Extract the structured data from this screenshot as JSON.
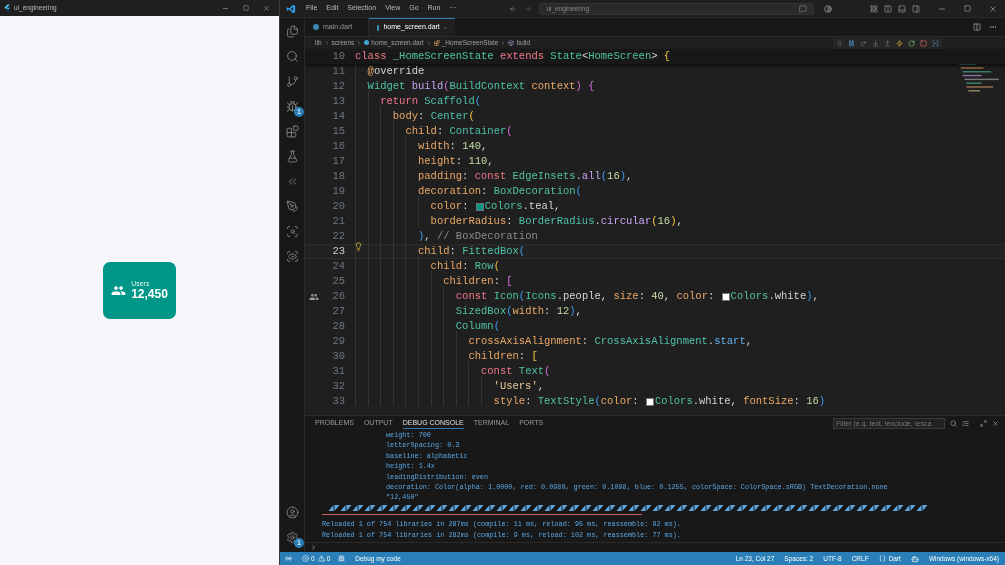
{
  "app_window": {
    "title": "ui_engineering",
    "card": {
      "label": "Users",
      "value": "12,450"
    }
  },
  "vscode": {
    "menu": [
      "File",
      "Edit",
      "Selection",
      "View",
      "Go",
      "Run",
      "···"
    ],
    "command_center": "ui_engineering",
    "activity_bar": [
      {
        "kind": "files"
      },
      {
        "kind": "search"
      },
      {
        "kind": "source-control"
      },
      {
        "kind": "run-debug",
        "badge": "1"
      },
      {
        "kind": "extensions"
      },
      {
        "kind": "testing"
      },
      {
        "kind": "flutter"
      },
      {
        "kind": "pen"
      },
      {
        "kind": "scan"
      },
      {
        "kind": "preview"
      }
    ],
    "activity_bottom": [
      {
        "kind": "account"
      },
      {
        "kind": "settings",
        "badge": "1"
      }
    ],
    "tabs": [
      {
        "label": "main.dart",
        "selected": false
      },
      {
        "label": "home_screen.dart",
        "selected": true
      }
    ],
    "breadcrumb": [
      {
        "label": "lib",
        "kind": "folder"
      },
      {
        "label": "screens",
        "kind": "folder"
      },
      {
        "label": "home_screen.dart",
        "kind": "file"
      },
      {
        "label": "_HomeScreenState",
        "kind": "class"
      },
      {
        "label": "build",
        "kind": "method"
      }
    ],
    "editor": {
      "lines": [
        {
          "number": "10",
          "sticky": true,
          "tokens": [
            {
              "text": "class ",
              "kind": "keyword"
            },
            {
              "text": "_HomeScreenState ",
              "kind": "type"
            },
            {
              "text": "extends ",
              "kind": "keyword"
            },
            {
              "text": "State",
              "kind": "type"
            },
            {
              "text": "<",
              "kind": "plain"
            },
            {
              "text": "HomeScreen",
              "kind": "type"
            },
            {
              "text": "> ",
              "kind": "plain"
            },
            {
              "text": "{",
              "kind": "bracket1"
            }
          ]
        },
        {
          "number": "11",
          "tokens": [
            {
              "text": "  @",
              "kind": "property"
            },
            {
              "text": "override",
              "kind": "plain"
            }
          ]
        },
        {
          "number": "12",
          "tokens": [
            {
              "text": "  Widget ",
              "kind": "type"
            },
            {
              "text": "build",
              "kind": "function"
            },
            {
              "text": "(",
              "kind": "bracket2"
            },
            {
              "text": "BuildContext ",
              "kind": "type"
            },
            {
              "text": "context",
              "kind": "property"
            },
            {
              "text": ")",
              "kind": "bracket2"
            },
            {
              "text": " {",
              "kind": "bracket2"
            }
          ]
        },
        {
          "number": "13",
          "tokens": [
            {
              "text": "    return ",
              "kind": "keyword"
            },
            {
              "text": "Scaffold",
              "kind": "type"
            },
            {
              "text": "(",
              "kind": "bracket3"
            }
          ]
        },
        {
          "number": "14",
          "tokens": [
            {
              "text": "      body",
              "kind": "property"
            },
            {
              "text": ": ",
              "kind": "plain"
            },
            {
              "text": "Center",
              "kind": "type"
            },
            {
              "text": "(",
              "kind": "bracket1"
            }
          ]
        },
        {
          "number": "15",
          "tokens": [
            {
              "text": "        child",
              "kind": "property"
            },
            {
              "text": ": ",
              "kind": "plain"
            },
            {
              "text": "Container",
              "kind": "type"
            },
            {
              "text": "(",
              "kind": "bracket2"
            }
          ]
        },
        {
          "number": "16",
          "tokens": [
            {
              "text": "          width",
              "kind": "property"
            },
            {
              "text": ": ",
              "kind": "plain"
            },
            {
              "text": "140",
              "kind": "number"
            },
            {
              "text": ",",
              "kind": "plain"
            }
          ]
        },
        {
          "number": "17",
          "tokens": [
            {
              "text": "          height",
              "kind": "property"
            },
            {
              "text": ": ",
              "kind": "plain"
            },
            {
              "text": "110",
              "kind": "number"
            },
            {
              "text": ",",
              "kind": "plain"
            }
          ]
        },
        {
          "number": "18",
          "tokens": [
            {
              "text": "          padding",
              "kind": "property"
            },
            {
              "text": ": ",
              "kind": "plain"
            },
            {
              "text": "const ",
              "kind": "keyword"
            },
            {
              "text": "EdgeInsets",
              "kind": "type"
            },
            {
              "text": ".",
              "kind": "plain"
            },
            {
              "text": "all",
              "kind": "function"
            },
            {
              "text": "(",
              "kind": "bracket3"
            },
            {
              "text": "16",
              "kind": "number"
            },
            {
              "text": ")",
              "kind": "bracket3"
            },
            {
              "text": ",",
              "kind": "plain"
            }
          ]
        },
        {
          "number": "19",
          "tokens": [
            {
              "text": "          decoration",
              "kind": "property"
            },
            {
              "text": ": ",
              "kind": "plain"
            },
            {
              "text": "BoxDecoration",
              "kind": "type"
            },
            {
              "text": "(",
              "kind": "bracket3"
            }
          ]
        },
        {
          "number": "20",
          "tokens": [
            {
              "text": "            color",
              "kind": "property"
            },
            {
              "text": ": ",
              "kind": "plain"
            },
            {
              "kind": "swatch",
              "color": "#009688"
            },
            {
              "text": "Colors",
              "kind": "type"
            },
            {
              "text": ".",
              "kind": "plain"
            },
            {
              "text": "teal",
              "kind": "plain"
            },
            {
              "text": ",",
              "kind": "plain"
            }
          ]
        },
        {
          "number": "21",
          "tokens": [
            {
              "text": "            borderRadius",
              "kind": "property"
            },
            {
              "text": ": ",
              "kind": "plain"
            },
            {
              "text": "BorderRadius",
              "kind": "type"
            },
            {
              "text": ".",
              "kind": "plain"
            },
            {
              "text": "circular",
              "kind": "function"
            },
            {
              "text": "(",
              "kind": "bracket1"
            },
            {
              "text": "16",
              "kind": "number"
            },
            {
              "text": ")",
              "kind": "bracket1"
            },
            {
              "text": ",",
              "kind": "plain"
            }
          ]
        },
        {
          "number": "22",
          "tokens": [
            {
              "text": "          )",
              "kind": "bracket3"
            },
            {
              "text": ", ",
              "kind": "plain"
            },
            {
              "text": "// BoxDecoration",
              "kind": "comment"
            }
          ]
        },
        {
          "number": "23",
          "current": true,
          "gutter": {
            "kind": "lightbulb"
          },
          "tokens": [
            {
              "text": "          child",
              "kind": "property"
            },
            {
              "text": ": ",
              "kind": "plain"
            },
            {
              "text": "FittedBox",
              "kind": "type"
            },
            {
              "text": "(",
              "kind": "bracket3"
            }
          ]
        },
        {
          "number": "24",
          "tokens": [
            {
              "text": "            child",
              "kind": "property"
            },
            {
              "text": ": ",
              "kind": "plain"
            },
            {
              "text": "Row",
              "kind": "type"
            },
            {
              "text": "(",
              "kind": "bracket1"
            }
          ]
        },
        {
          "number": "25",
          "tokens": [
            {
              "text": "              children",
              "kind": "property"
            },
            {
              "text": ": ",
              "kind": "plain"
            },
            {
              "text": "[",
              "kind": "bracket2"
            }
          ]
        },
        {
          "number": "26",
          "gutter": {
            "kind": "people"
          },
          "tokens": [
            {
              "text": "                const ",
              "kind": "keyword"
            },
            {
              "text": "Icon",
              "kind": "type"
            },
            {
              "text": "(",
              "kind": "bracket3"
            },
            {
              "text": "Icons",
              "kind": "type"
            },
            {
              "text": ".",
              "kind": "plain"
            },
            {
              "text": "people",
              "kind": "plain"
            },
            {
              "text": ", ",
              "kind": "plain"
            },
            {
              "text": "size",
              "kind": "property"
            },
            {
              "text": ": ",
              "kind": "plain"
            },
            {
              "text": "40",
              "kind": "number"
            },
            {
              "text": ", ",
              "kind": "plain"
            },
            {
              "text": "color",
              "kind": "property"
            },
            {
              "text": ": ",
              "kind": "plain"
            },
            {
              "kind": "swatch",
              "color": "#ffffff"
            },
            {
              "text": "Colors",
              "kind": "type"
            },
            {
              "text": ".",
              "kind": "plain"
            },
            {
              "text": "white",
              "kind": "plain"
            },
            {
              "text": ")",
              "kind": "bracket3"
            },
            {
              "text": ",",
              "kind": "plain"
            }
          ]
        },
        {
          "number": "27",
          "tokens": [
            {
              "text": "                SizedBox",
              "kind": "type"
            },
            {
              "text": "(",
              "kind": "bracket3"
            },
            {
              "text": "width",
              "kind": "property"
            },
            {
              "text": ": ",
              "kind": "plain"
            },
            {
              "text": "12",
              "kind": "number"
            },
            {
              "text": ")",
              "kind": "bracket3"
            },
            {
              "text": ",",
              "kind": "plain"
            }
          ]
        },
        {
          "number": "28",
          "tokens": [
            {
              "text": "                Column",
              "kind": "type"
            },
            {
              "text": "(",
              "kind": "bracket3"
            }
          ]
        },
        {
          "number": "29",
          "tokens": [
            {
              "text": "                  crossAxisAlignment",
              "kind": "property"
            },
            {
              "text": ": ",
              "kind": "plain"
            },
            {
              "text": "CrossAxisAlignment",
              "kind": "type"
            },
            {
              "text": ".",
              "kind": "plain"
            },
            {
              "text": "start",
              "kind": "enum"
            },
            {
              "text": ",",
              "kind": "plain"
            }
          ]
        },
        {
          "number": "30",
          "tokens": [
            {
              "text": "                  children",
              "kind": "property"
            },
            {
              "text": ": ",
              "kind": "plain"
            },
            {
              "text": "[",
              "kind": "bracket1"
            }
          ]
        },
        {
          "number": "31",
          "tokens": [
            {
              "text": "                    const ",
              "kind": "keyword"
            },
            {
              "text": "Text",
              "kind": "type"
            },
            {
              "text": "(",
              "kind": "bracket2"
            }
          ]
        },
        {
          "number": "32",
          "tokens": [
            {
              "text": "                      'Users'",
              "kind": "string"
            },
            {
              "text": ",",
              "kind": "plain"
            }
          ]
        },
        {
          "number": "33",
          "tokens": [
            {
              "text": "                      style",
              "kind": "property"
            },
            {
              "text": ": ",
              "kind": "plain"
            },
            {
              "text": "TextStyle",
              "kind": "type"
            },
            {
              "text": "(",
              "kind": "bracket3"
            },
            {
              "text": "color",
              "kind": "property"
            },
            {
              "text": ": ",
              "kind": "plain"
            },
            {
              "kind": "swatch",
              "color": "#ffffff"
            },
            {
              "text": "Colors",
              "kind": "type"
            },
            {
              "text": ".",
              "kind": "plain"
            },
            {
              "text": "white",
              "kind": "plain"
            },
            {
              "text": ", ",
              "kind": "plain"
            },
            {
              "text": "fontSize",
              "kind": "property"
            },
            {
              "text": ": ",
              "kind": "plain"
            },
            {
              "text": "16",
              "kind": "number"
            },
            {
              "text": ")",
              "kind": "bracket3"
            }
          ]
        }
      ]
    },
    "panel": {
      "tabs": [
        {
          "label": "PROBLEMS",
          "selected": false
        },
        {
          "label": "OUTPUT",
          "selected": false
        },
        {
          "label": "DEBUG CONSOLE",
          "selected": true
        },
        {
          "label": "TERMINAL",
          "selected": false
        },
        {
          "label": "PORTS",
          "selected": false
        }
      ],
      "filter_placeholder": "Filter (e.g. text, !exclude, \\esca",
      "details": [
        "weight: 700",
        "letterSpacing: 0.3",
        "baseline: alphabetic",
        "height: 1.4x",
        "leadingDistribution: even",
        "decoration: Color(alpha: 1.0000, red: 0.0980, green: 0.1098, blue: 0.1255, colorSpace: ColorSpace.sRGB) TextDecoration.none",
        "\"12,450\""
      ],
      "reloads": [
        "Reloaded 1 of 754 libraries in 287ms (compile: 11 ms, reload: 95 ms, reassemble: 92 ms).",
        "Reloaded 1 of 754 libraries in 282ms (compile: 9 ms, reload: 102 ms, reassemble: 77 ms)."
      ]
    },
    "status_bar": {
      "errors": "0",
      "warnings": "0",
      "debug_label": "Debug my code",
      "items": [
        "Ln 23, Col 27",
        "Spaces: 2",
        "UTF-8",
        "CRLF"
      ],
      "language": "Dart",
      "platform": "Windows (windows-x64)"
    }
  }
}
